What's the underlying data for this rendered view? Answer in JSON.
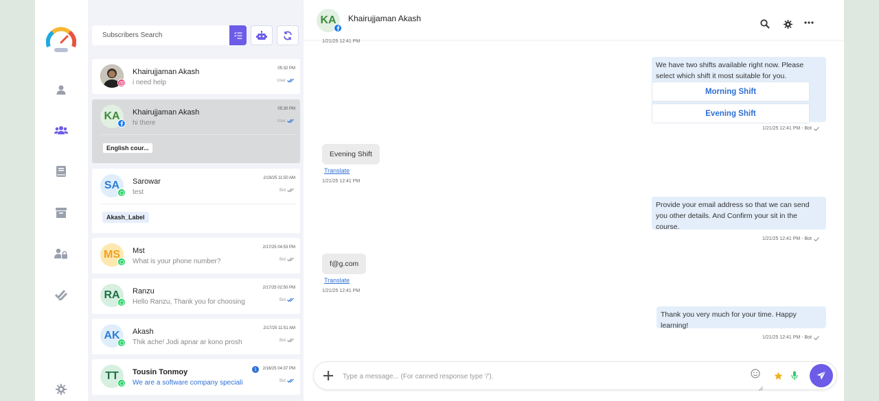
{
  "colors": {
    "accent": "#6c5ce7",
    "link": "#2d6fd6",
    "bubble_out": "#e3eefa",
    "bubble_in": "#ebebeb",
    "whatsapp": "#25d366",
    "facebook": "#1877f2"
  },
  "search": {
    "placeholder": "Subscribers Search"
  },
  "conversations": [
    {
      "name": "Khairujjaman Akash",
      "preview": "i need help",
      "time": "05:32 PM",
      "status": "User",
      "channel": "instagram",
      "avatar": "photo"
    },
    {
      "name": "Khairujjaman Akash",
      "preview": "hi there",
      "time": "05:30 PM",
      "status": "User",
      "channel": "facebook",
      "initials": "KA",
      "label": "English cour..."
    },
    {
      "name": "Sarowar",
      "preview": "test",
      "time": "2/19/25 11:50 AM",
      "status": "Bot",
      "channel": "whatsapp",
      "initials": "SA",
      "label": "Akash_Label"
    },
    {
      "name": "Mst",
      "preview": "What is your phone number?",
      "time": "2/17/25 04:53 PM",
      "status": "Bot",
      "channel": "whatsapp",
      "initials": "MS"
    },
    {
      "name": "Ranzu",
      "preview": "Hello Ranzu, Thank you for choosing",
      "time": "2/17/25 02:50 PM",
      "status": "Bot",
      "channel": "whatsapp",
      "initials": "RA"
    },
    {
      "name": "Akash",
      "preview": "Thik ache! Jodi apnar ar kono prosh",
      "time": "2/17/25 11:51 AM",
      "status": "Bot",
      "channel": "whatsapp",
      "initials": "AK"
    },
    {
      "name": "Tousin Tonmoy",
      "preview": "We are a software company speciali",
      "time": "2/16/25 04:37 PM",
      "status": "Bot",
      "channel": "whatsapp",
      "initials": "TT",
      "unread": "1"
    }
  ],
  "header": {
    "initials": "KA",
    "name": "Khairujjaman Akash"
  },
  "messages": {
    "top_timestamp": "1/21/25 12:41 PM",
    "m1": {
      "text": "We have two shifts available right now. Please select which shift it most suitable for you.",
      "buttons": [
        "Morning Shift",
        "Evening Shift"
      ],
      "meta": "1/21/25 12:41 PM - Bot"
    },
    "m2": {
      "text": "Evening Shift",
      "translate": "Translate",
      "meta": "1/21/25 12:41 PM"
    },
    "m3": {
      "text": "Provide your email address so that we can send you other details. And Confirm your sit in the course.",
      "meta": "1/21/25 12:41 PM - Bot"
    },
    "m4": {
      "text": "f@g.com",
      "translate": "Translate",
      "meta": "1/21/25 12:41 PM"
    },
    "m5": {
      "text": "Thank you very much for your time. Happy learning!",
      "meta": "1/21/25 12:41 PM - Bot"
    }
  },
  "composer": {
    "placeholder": "Type a message... (For canned response type '/')."
  }
}
